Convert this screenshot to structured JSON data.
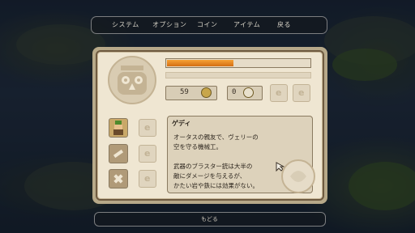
{
  "menu": {
    "items": [
      "システム",
      "オプション",
      "コイン",
      "アイテム",
      "戻る"
    ]
  },
  "status": {
    "health_fraction": 0.46,
    "stat1_value": "59",
    "stat2_value": "0"
  },
  "slot_glyph": "e",
  "dialog": {
    "name": "ゲディ",
    "lines": [
      "オータスの親友で、ヴェリーの",
      "空を守る機械工。",
      "",
      "武器のブラスター銃は大半の",
      "敵にダメージを与えるが、",
      "かたい岩や鉄には効果がない。"
    ]
  },
  "bottom": {
    "label": "もどる"
  },
  "colors": {
    "accent_orange": "#f6a236",
    "panel": "#efe6d2",
    "ink": "#2d261e"
  }
}
